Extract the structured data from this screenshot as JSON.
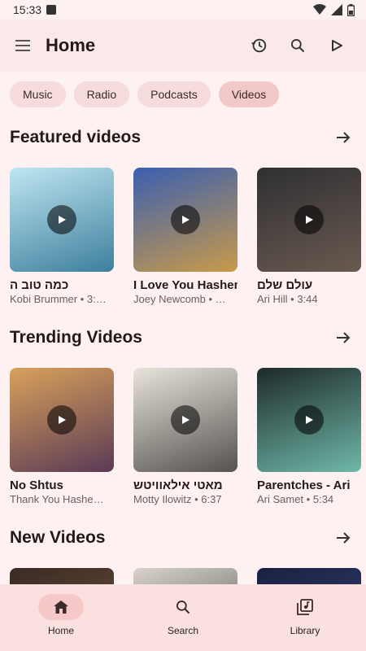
{
  "status": {
    "time": "15:33"
  },
  "top_bar": {
    "title": "Home"
  },
  "chips": [
    {
      "label": "Music"
    },
    {
      "label": "Radio"
    },
    {
      "label": "Podcasts"
    },
    {
      "label": "Videos"
    }
  ],
  "sections": [
    {
      "title": "Featured videos",
      "items": [
        {
          "title": "כמה טוב ה",
          "subtitle": "Kobi Brummer • 3:…",
          "thumb_colors": [
            "#bfe6f2",
            "#3d7f9c"
          ]
        },
        {
          "title": "I Love You Hashem",
          "subtitle": "Joey Newcomb • …",
          "thumb_colors": [
            "#3a5fb0",
            "#c89a4a"
          ]
        },
        {
          "title": "עולם שלם",
          "subtitle": "Ari Hill • 3:44",
          "thumb_colors": [
            "#2f2f33",
            "#6a5a50"
          ]
        }
      ]
    },
    {
      "title": "Trending Videos",
      "items": [
        {
          "title": "No Shtus",
          "subtitle": "Thank You Hashe…",
          "thumb_colors": [
            "#d9a15b",
            "#5a3a55"
          ]
        },
        {
          "title": "מאטי אילאוויטש",
          "subtitle": "Motty Ilowitz • 6:37",
          "thumb_colors": [
            "#e8e4dc",
            "#55534f"
          ]
        },
        {
          "title": "Parentches - Ari",
          "subtitle": "Ari Samet • 5:34",
          "thumb_colors": [
            "#1e2a2a",
            "#6fb8a8"
          ]
        }
      ]
    },
    {
      "title": "New Videos",
      "items": [
        {
          "title": "",
          "subtitle": "",
          "thumb_colors": [
            "#3a2a24",
            "#7a5a40"
          ]
        },
        {
          "title": "",
          "subtitle": "",
          "thumb_colors": [
            "#d8d4cc",
            "#3a3a3a"
          ]
        },
        {
          "title": "",
          "subtitle": "",
          "thumb_colors": [
            "#1a2040",
            "#3a4a80"
          ]
        }
      ]
    }
  ],
  "nav": [
    {
      "label": "Home",
      "icon": "home-icon",
      "active": true
    },
    {
      "label": "Search",
      "icon": "search-icon",
      "active": false
    },
    {
      "label": "Library",
      "icon": "library-icon",
      "active": false
    }
  ]
}
